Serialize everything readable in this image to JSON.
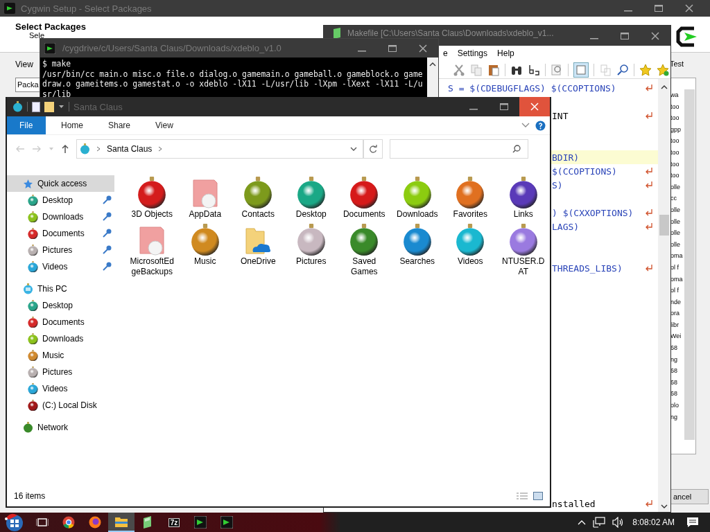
{
  "cygwin_setup": {
    "title": "Cygwin Setup - Select Packages",
    "heading": "Select Packages",
    "subtitle": "Sele",
    "view_label": "View",
    "package_button": "Packa",
    "column_header": "Test",
    "list_items": [
      "wa",
      "too",
      "too",
      "gpp",
      "too",
      "too",
      "too",
      "too",
      "olle",
      "cc",
      "olle",
      "olle",
      "olle",
      "olle",
      "oma",
      "ol f",
      "oma",
      "ol f",
      "nde",
      "ora",
      "libr",
      "Wei",
      "68",
      "ng",
      "68",
      "68",
      "68",
      "olo",
      "ng"
    ],
    "cancel_button": "ancel"
  },
  "editor": {
    "title": "Makefile [C:\\Users\\Santa Claus\\Downloads\\xdeblo_v1...",
    "menu": [
      "e",
      "Settings",
      "Help"
    ],
    "code_lines": [
      {
        "text": "S = $(CDEBUGFLAGS) $(CCOPTIONS)",
        "kind": "macro",
        "wrap": true,
        "current": false
      },
      {
        "wrap": false,
        "current": false
      },
      {
        "text": "INT",
        "kind": "plain",
        "wrap": true,
        "current": false
      },
      {
        "wrap": false,
        "current": false
      },
      {
        "wrap": false,
        "current": false
      },
      {
        "text": "BDIR)",
        "kind": "macro",
        "wrap": false,
        "current": true
      },
      {
        "text": "$(CCOPTIONS)",
        "kind": "macro",
        "wrap": true,
        "current": false
      },
      {
        "text": "S)",
        "kind": "macro",
        "wrap": true,
        "current": false
      },
      {
        "wrap": false,
        "current": false
      },
      {
        "text": ") $(CXXOPTIONS)",
        "kind": "macro",
        "wrap": true,
        "current": false
      },
      {
        "text": "LAGS)",
        "kind": "macro",
        "wrap": true,
        "current": false
      },
      {
        "wrap": false,
        "current": false
      },
      {
        "wrap": false,
        "current": false
      },
      {
        "text": "THREADS_LIBS)",
        "kind": "macro",
        "wrap": true,
        "current": false
      },
      {
        "wrap": false,
        "current": false
      },
      {
        "wrap": false,
        "current": false
      },
      {
        "wrap": false,
        "current": false
      },
      {
        "wrap": false,
        "current": false
      },
      {
        "wrap": false,
        "current": false
      },
      {
        "wrap": false,
        "current": false
      },
      {
        "wrap": false,
        "current": false
      },
      {
        "wrap": false,
        "current": false
      },
      {
        "wrap": false,
        "current": false
      },
      {
        "wrap": false,
        "current": false
      },
      {
        "wrap": false,
        "current": false
      },
      {
        "wrap": false,
        "current": false
      },
      {
        "wrap": false,
        "current": false
      },
      {
        "wrap": false,
        "current": false
      },
      {
        "wrap": false,
        "current": false
      },
      {
        "wrap": false,
        "current": false
      },
      {
        "text": "nstalled",
        "kind": "plain",
        "wrap": true,
        "current": false
      }
    ]
  },
  "terminal": {
    "title": "/cygdrive/c/Users/Santa Claus/Downloads/xdeblo_v1.0",
    "lines": [
      "$ make",
      "/usr/bin/cc main.o misc.o file.o dialog.o gamemain.o gameball.o gameblock.o game",
      "draw.o gameitems.o gamestat.o -o xdeblo -lX11 -L/usr/lib -lXpm -lXext -lX11 -L/u",
      "sr/lib"
    ]
  },
  "explorer": {
    "title": "Santa Claus",
    "ribbon_tabs": [
      {
        "label": "File",
        "kind": "file"
      },
      {
        "label": "Home",
        "kind": "tab"
      },
      {
        "label": "Share",
        "kind": "tab"
      },
      {
        "label": "View",
        "kind": "tab"
      }
    ],
    "breadcrumb": "Santa Claus",
    "navigation": [
      {
        "label": "Quick access",
        "kind": "star",
        "selected": true,
        "children": [
          {
            "label": "Desktop",
            "color": "#2aa58a",
            "pinned": true,
            "selected": false
          },
          {
            "label": "Downloads",
            "color": "#8cc21c",
            "pinned": true,
            "selected": false
          },
          {
            "label": "Documents",
            "color": "#d62a2a",
            "pinned": true,
            "selected": false
          },
          {
            "label": "Pictures",
            "color": "#b8b0b0",
            "pinned": true,
            "selected": false
          },
          {
            "label": "Videos",
            "color": "#2aa7d8",
            "pinned": true,
            "selected": false
          }
        ]
      },
      {
        "label": "This PC",
        "kind": "pc",
        "selected": false,
        "children": [
          {
            "label": "Desktop",
            "color": "#2aa58a",
            "pinned": false,
            "selected": false
          },
          {
            "label": "Documents",
            "color": "#d62a2a",
            "pinned": false,
            "selected": false
          },
          {
            "label": "Downloads",
            "color": "#8cc21c",
            "pinned": false,
            "selected": false
          },
          {
            "label": "Music",
            "color": "#d08a30",
            "pinned": false,
            "selected": false
          },
          {
            "label": "Pictures",
            "color": "#b8b0b0",
            "pinned": false,
            "selected": false
          },
          {
            "label": "Videos",
            "color": "#2aa7d8",
            "pinned": false,
            "selected": false
          },
          {
            "label": "(C:) Local Disk",
            "color": "#a01818",
            "pinned": false,
            "selected": false
          }
        ]
      },
      {
        "label": "Network",
        "kind": "network",
        "selected": false
      }
    ],
    "items": [
      {
        "label": "3D Objects",
        "kind": "ornament",
        "color": "#d41c1c"
      },
      {
        "label": "AppData",
        "kind": "file"
      },
      {
        "label": "Contacts",
        "kind": "ornament",
        "color": "#7d9a1c"
      },
      {
        "label": "Desktop",
        "kind": "ornament",
        "color": "#1aa886"
      },
      {
        "label": "Documents",
        "kind": "ornament",
        "color": "#d61a1a"
      },
      {
        "label": "Downloads",
        "kind": "ornament",
        "color": "#8ccc10"
      },
      {
        "label": "Favorites",
        "kind": "ornament",
        "color": "#e07020"
      },
      {
        "label": "Links",
        "kind": "ornament",
        "color": "#5a3ab8"
      },
      {
        "label": "MicrosoftEdgeBackups",
        "kind": "file"
      },
      {
        "label": "Music",
        "kind": "ornament",
        "color": "#d08a20"
      },
      {
        "label": "OneDrive",
        "kind": "folder"
      },
      {
        "label": "Pictures",
        "kind": "ornament",
        "color": "#c8b8c0"
      },
      {
        "label": "Saved Games",
        "kind": "ornament",
        "color": "#3a8a2a"
      },
      {
        "label": "Searches",
        "kind": "ornament",
        "color": "#1a8ad0"
      },
      {
        "label": "Videos",
        "kind": "ornament",
        "color": "#1ab8d0"
      },
      {
        "label": "NTUSER.DAT",
        "kind": "ornament",
        "color": "#9a7ae0"
      }
    ],
    "status": "16 items"
  },
  "taskbar": {
    "apps": [
      {
        "kind": "taskview",
        "active": false
      },
      {
        "kind": "chrome",
        "active": false
      },
      {
        "kind": "firefox",
        "active": false
      },
      {
        "kind": "explorer",
        "active": true
      },
      {
        "kind": "notepad",
        "active": false
      },
      {
        "kind": "archiver",
        "label": "7z",
        "active": false
      },
      {
        "kind": "terminal",
        "active": false
      },
      {
        "kind": "terminal",
        "active": false
      }
    ],
    "clock": "8:08:02 AM"
  }
}
